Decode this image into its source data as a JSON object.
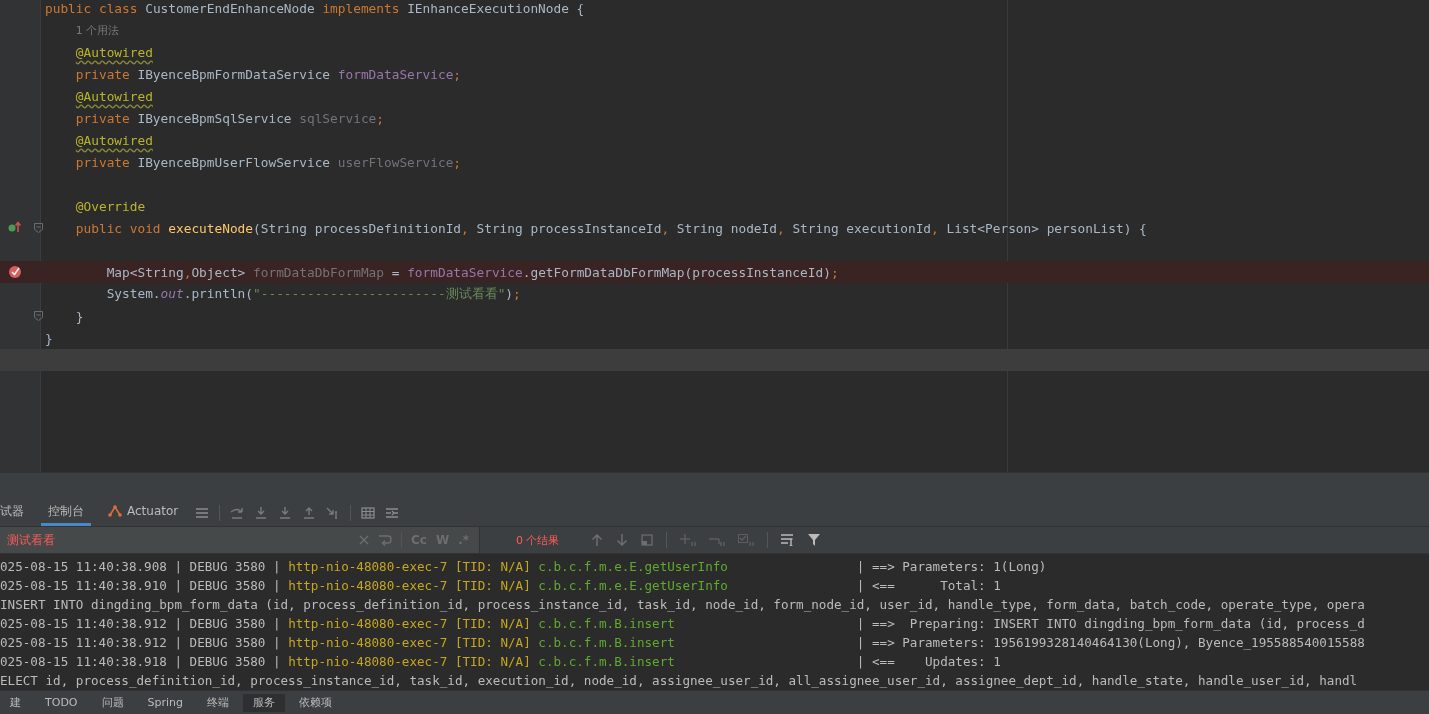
{
  "editor": {
    "lines": [
      {
        "fold": false,
        "current": false,
        "tokens": [
          {
            "t": "public class ",
            "kind": "kw"
          },
          {
            "t": "CustomerEndEnhanceNode ",
            "kind": "plain"
          },
          {
            "t": "implements ",
            "kind": "kw"
          },
          {
            "t": "IEnhanceExecutionNode {",
            "kind": "plain"
          }
        ],
        "children": [
          {
            "fold": false,
            "current": false,
            "tokens": [
              {
                "t": "1 个用法",
                "kind": "hint"
              }
            ]
          },
          {
            "fold": false,
            "current": false,
            "tokens": [
              {
                "t": "@Autowired",
                "kind": "annotation_warn"
              }
            ]
          },
          {
            "fold": false,
            "current": false,
            "tokens": [
              {
                "t": "private ",
                "kind": "kw"
              },
              {
                "t": "IByenceBpmFormDataService ",
                "kind": "plain"
              },
              {
                "t": "formDataService",
                "kind": "field"
              },
              {
                "t": ";",
                "kind": "kw"
              }
            ]
          },
          {
            "fold": false,
            "current": false,
            "tokens": [
              {
                "t": "@Autowired",
                "kind": "annotation_warn"
              }
            ]
          },
          {
            "fold": false,
            "current": false,
            "tokens": [
              {
                "t": "private ",
                "kind": "kw"
              },
              {
                "t": "IByenceBpmSqlService ",
                "kind": "plain"
              },
              {
                "t": "sqlService",
                "kind": "unused"
              },
              {
                "t": ";",
                "kind": "kw"
              }
            ]
          },
          {
            "fold": false,
            "current": false,
            "tokens": [
              {
                "t": "@Autowired",
                "kind": "annotation_warn"
              }
            ]
          },
          {
            "fold": false,
            "current": false,
            "tokens": [
              {
                "t": "private ",
                "kind": "kw"
              },
              {
                "t": "IByenceBpmUserFlowService ",
                "kind": "plain"
              },
              {
                "t": "userFlowService",
                "kind": "unused"
              },
              {
                "t": ";",
                "kind": "kw"
              }
            ]
          },
          {
            "fold": false,
            "current": false
          },
          {
            "fold": false,
            "current": false,
            "tokens": [
              {
                "t": "@Override",
                "kind": "annotation"
              }
            ]
          },
          {
            "fold": true,
            "current": false,
            "kind": "implements",
            "tokens": [
              {
                "t": "public void ",
                "kind": "kw"
              },
              {
                "t": "executeNode",
                "kind": "method"
              },
              {
                "t": "(String processDefinitionId",
                "kind": "plain"
              },
              {
                "t": ", ",
                "kind": "kw"
              },
              {
                "t": "String processInstanceId",
                "kind": "plain"
              },
              {
                "t": ", ",
                "kind": "kw"
              },
              {
                "t": "String nodeId",
                "kind": "plain"
              },
              {
                "t": ", ",
                "kind": "kw"
              },
              {
                "t": "String executionId",
                "kind": "plain"
              },
              {
                "t": ", ",
                "kind": "kw"
              },
              {
                "t": "List<Person> personList) {",
                "kind": "plain"
              }
            ],
            "children": [
              {
                "fold": false,
                "current": false
              },
              {
                "fold": false,
                "current": false,
                "kind": "breakpoint",
                "tokens": [
                  {
                    "t": "Map<String",
                    "kind": "plain"
                  },
                  {
                    "t": ",",
                    "kind": "kw"
                  },
                  {
                    "t": "Object> ",
                    "kind": "plain"
                  },
                  {
                    "t": "formDataDbFormMap",
                    "kind": "unused"
                  },
                  {
                    "t": " = ",
                    "kind": "plain"
                  },
                  {
                    "t": "formDataService",
                    "kind": "field"
                  },
                  {
                    "t": ".getFormDataDbFormMap(processInstanceId)",
                    "kind": "plain"
                  },
                  {
                    "t": ";",
                    "kind": "kw"
                  }
                ]
              },
              {
                "fold": false,
                "current": false,
                "tokens": [
                  {
                    "t": "System.",
                    "kind": "plain"
                  },
                  {
                    "t": "out",
                    "kind": "static"
                  },
                  {
                    "t": ".println(",
                    "kind": "plain"
                  },
                  {
                    "t": "\"------------------------测试看看\"",
                    "kind": "string"
                  },
                  {
                    "t": ")",
                    "kind": "plain"
                  },
                  {
                    "t": ";",
                    "kind": "kw"
                  }
                ]
              }
            ]
          },
          {
            "fold": true,
            "current": false,
            "tokens": [
              {
                "t": "}",
                "kind": "plain"
              }
            ]
          }
        ]
      },
      {
        "fold": false,
        "current": false,
        "tokens": [
          {
            "t": "}",
            "kind": "plain"
          }
        ]
      },
      {
        "fold": false,
        "current": true
      }
    ]
  },
  "tool_window": {
    "tabs": [
      {
        "label": "试器",
        "selected": false,
        "kind": "plain"
      },
      {
        "label": "控制台",
        "selected": true,
        "kind": "plain"
      },
      {
        "label": "Actuator",
        "selected": false,
        "kind": "actuator"
      }
    ],
    "search": {
      "value": "测试看看",
      "options": [
        "Cc",
        "W",
        ".*"
      ],
      "result": "0 个结果"
    },
    "console": {
      "lines": [
        {
          "kind": "log",
          "prefix": "025-08-15 11:40:38.908 | DEBUG 3580 | ",
          "thread": "http-nio-48080-exec-7 [TID: N/A]",
          "logger": "c.b.c.f.m.e.E.getUserInfo",
          "message": "| ==> Parameters: 1(Long)"
        },
        {
          "kind": "log",
          "prefix": "025-08-15 11:40:38.910 | DEBUG 3580 | ",
          "thread": "http-nio-48080-exec-7 [TID: N/A]",
          "logger": "c.b.c.f.m.e.E.getUserInfo",
          "message": "| <==      Total: 1"
        },
        {
          "kind": "sql",
          "text": "INSERT INTO dingding_bpm_form_data (id, process_definition_id, process_instance_id, task_id, node_id, form_node_id, user_id, handle_type, form_data, batch_code, operate_type, opera"
        },
        {
          "kind": "log",
          "prefix": "025-08-15 11:40:38.912 | DEBUG 3580 | ",
          "thread": "http-nio-48080-exec-7 [TID: N/A]",
          "logger": "c.b.c.f.m.B.insert",
          "message": "| ==>  Preparing: INSERT INTO dingding_bpm_form_data (id, process_d"
        },
        {
          "kind": "log",
          "prefix": "025-08-15 11:40:38.912 | DEBUG 3580 | ",
          "thread": "http-nio-48080-exec-7 [TID: N/A]",
          "logger": "c.b.c.f.m.B.insert",
          "message": "| ==> Parameters: 1956199328140464130(Long), Byence_195588540015588"
        },
        {
          "kind": "log",
          "prefix": "025-08-15 11:40:38.918 | DEBUG 3580 | ",
          "thread": "http-nio-48080-exec-7 [TID: N/A]",
          "logger": "c.b.c.f.m.B.insert",
          "message": "| <==    Updates: 1"
        },
        {
          "kind": "sql",
          "text": "ELECT id, process_definition_id, process_instance_id, task_id, execution_id, node_id, assignee_user_id, all_assignee_user_id, assignee_dept_id, handle_state, handle_user_id, handl"
        }
      ]
    }
  },
  "bottom_bar": {
    "tabs": [
      {
        "label": "建",
        "selected": false
      },
      {
        "label": "TODO",
        "selected": false
      },
      {
        "label": "问题",
        "selected": false
      },
      {
        "label": "Spring",
        "selected": false
      },
      {
        "label": "终端",
        "selected": false
      },
      {
        "label": "服务",
        "selected": true
      },
      {
        "label": "依赖项",
        "selected": false
      }
    ]
  }
}
